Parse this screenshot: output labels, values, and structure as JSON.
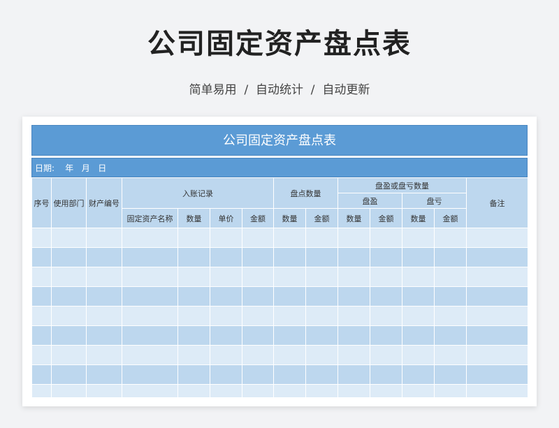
{
  "header": {
    "title": "公司固定资产盘点表",
    "subtitle": "简单易用  /  自动统计  /  自动更新"
  },
  "sheet": {
    "title": "公司固定资产盘点表",
    "date_label": "日期:    年   月   日",
    "columns": {
      "seq": "序号",
      "dept": "使用部门",
      "asset_no": "财产编号",
      "entry_group": "入账记录",
      "entry_name": "固定资产名称",
      "entry_qty": "数量",
      "entry_price": "单价",
      "entry_amount": "金额",
      "count_group": "盘点数量",
      "count_qty": "数量",
      "count_amount": "金额",
      "diff_group": "盘盈或盘亏数量",
      "surplus": "盘盈",
      "surplus_qty": "数量",
      "surplus_amount": "金额",
      "deficit": "盘亏",
      "deficit_qty": "数量",
      "deficit_amount": "金额",
      "remark": "备注"
    },
    "empty_rows": 9
  },
  "colors": {
    "header_blue": "#5b9bd5",
    "light_row": "#ddebf7",
    "mid_row": "#bdd7ee"
  }
}
